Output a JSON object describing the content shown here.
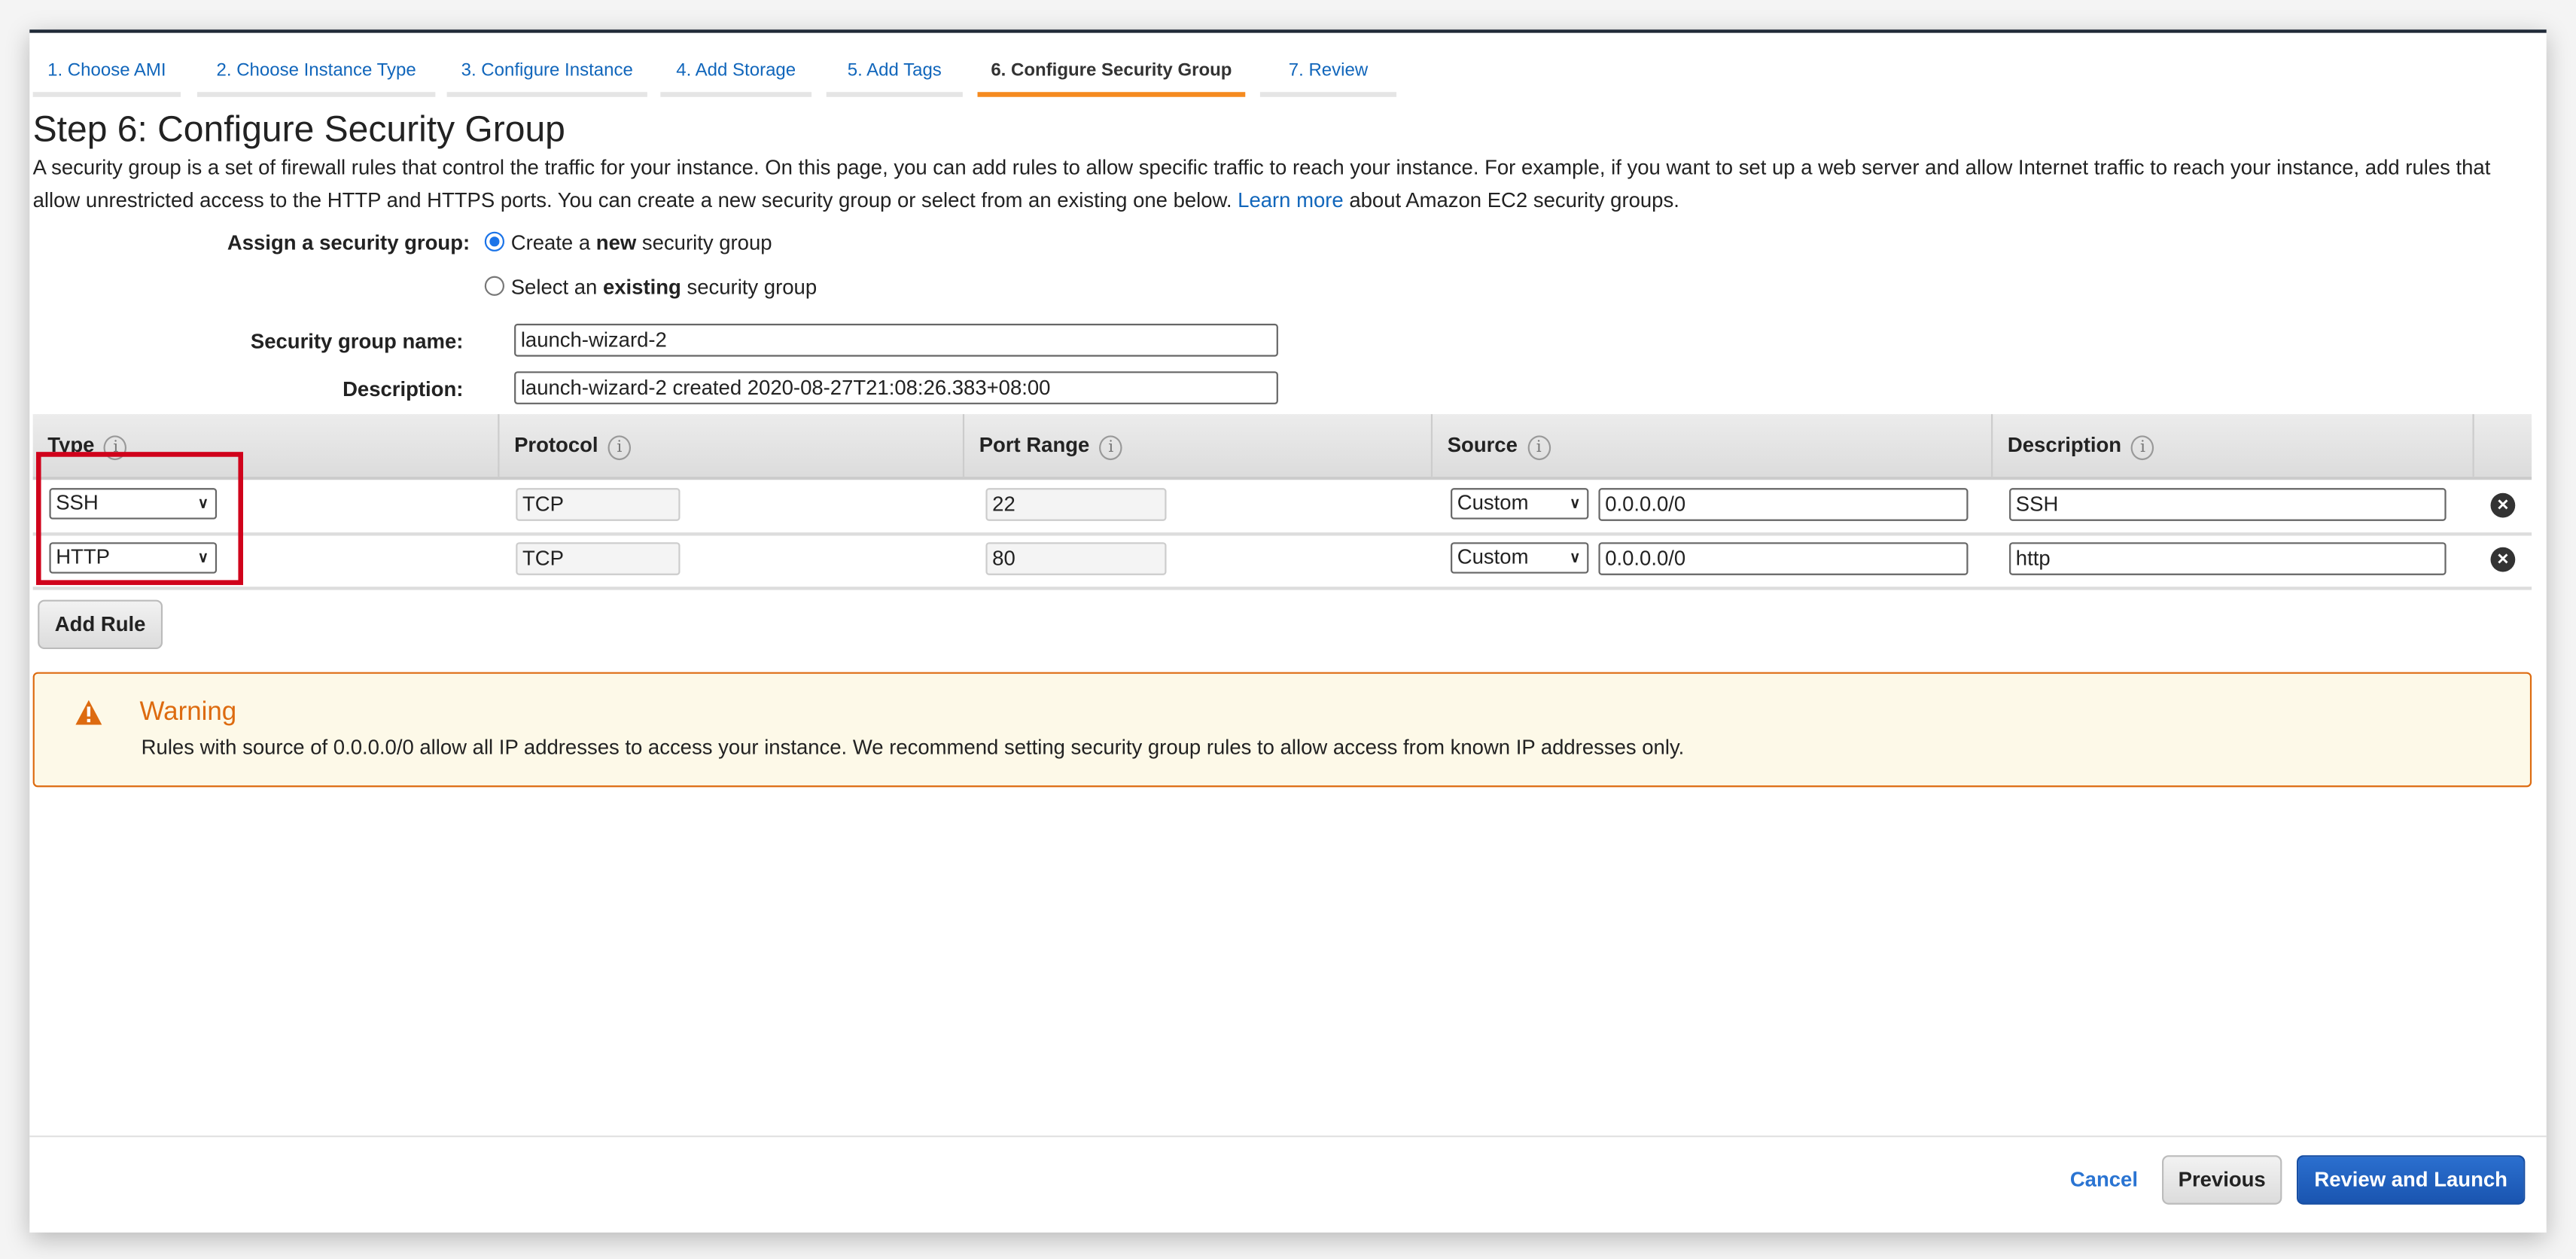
{
  "tabs": [
    {
      "label": "1. Choose AMI",
      "active": false
    },
    {
      "label": "2. Choose Instance Type",
      "active": false
    },
    {
      "label": "3. Configure Instance",
      "active": false
    },
    {
      "label": "4. Add Storage",
      "active": false
    },
    {
      "label": "5. Add Tags",
      "active": false
    },
    {
      "label": "6. Configure Security Group",
      "active": true
    },
    {
      "label": "7. Review",
      "active": false
    }
  ],
  "page": {
    "title": "Step 6: Configure Security Group",
    "description": "A security group is a set of firewall rules that control the traffic for your instance. On this page, you can add rules to allow specific traffic to reach your instance. For example, if you want to set up a web server and allow Internet traffic to reach your instance, add rules that allow unrestricted access to the HTTP and HTTPS ports. You can create a new security group or select from an existing one below.",
    "learn_more": "Learn more",
    "description_tail": "about Amazon EC2 security groups."
  },
  "form": {
    "assign_label": "Assign a security group:",
    "option_new_pre": "Create a ",
    "option_new_bold": "new",
    "option_new_post": " security group",
    "option_existing_pre": "Select an ",
    "option_existing_bold": "existing",
    "option_existing_post": " security group",
    "selected_option": "new",
    "name_label": "Security group name:",
    "name_value": "launch-wizard-2",
    "desc_label": "Description:",
    "desc_value": "launch-wizard-2 created 2020-08-27T21:08:26.383+08:00"
  },
  "table": {
    "headers": [
      "Type",
      "Protocol",
      "Port Range",
      "Source",
      "Description"
    ],
    "rows": [
      {
        "type": "SSH",
        "protocol": "TCP",
        "port": "22",
        "source_type": "Custom",
        "source": "0.0.0.0/0",
        "description": "SSH"
      },
      {
        "type": "HTTP",
        "protocol": "TCP",
        "port": "80",
        "source_type": "Custom",
        "source": "0.0.0.0/0",
        "description": "http"
      }
    ],
    "add_rule": "Add Rule"
  },
  "warning": {
    "title": "Warning",
    "text": "Rules with source of 0.0.0.0/0 allow all IP addresses to access your instance. We recommend setting security group rules to allow access from known IP addresses only.",
    "icon": "warning-triangle-icon",
    "color": "#dd6b10"
  },
  "footer": {
    "cancel": "Cancel",
    "previous": "Previous",
    "review_launch": "Review and Launch"
  },
  "colors": {
    "accent": "#1166bb",
    "active_tab": "#f58a1f",
    "primary_button": "#1a55b0",
    "highlight": "#d0021b"
  }
}
